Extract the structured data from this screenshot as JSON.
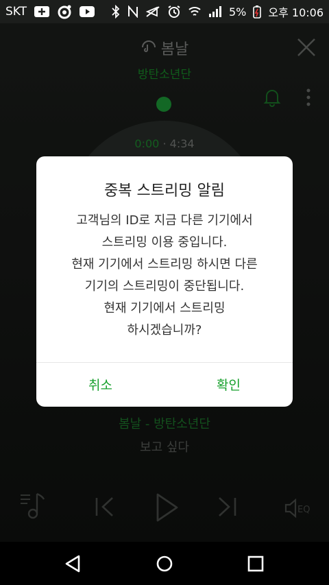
{
  "status_bar": {
    "carrier": "SKT",
    "battery": "5%",
    "time": "오후 10:06"
  },
  "player": {
    "song_title": "봄날",
    "artist": "방탄소년단",
    "current_time": "0:00",
    "separator": "·",
    "total_time": "4:34",
    "lyric_current": "봄날 - 방탄소년단",
    "lyric_next": "보고 싶다"
  },
  "dialog": {
    "title": "중복 스트리밍 알림",
    "lines": [
      "고객님의 ID로 지금 다른 기기에서",
      "스트리밍 이용 중입니다.",
      "현재 기기에서 스트리밍 하시면 다른",
      "기기의 스트리밍이 중단됩니다.",
      "현재 기기에서 스트리밍",
      "하시겠습니까?"
    ],
    "cancel_label": "취소",
    "confirm_label": "확인"
  },
  "colors": {
    "accent": "#17a02c",
    "dialog_bg": "#ffffff"
  }
}
